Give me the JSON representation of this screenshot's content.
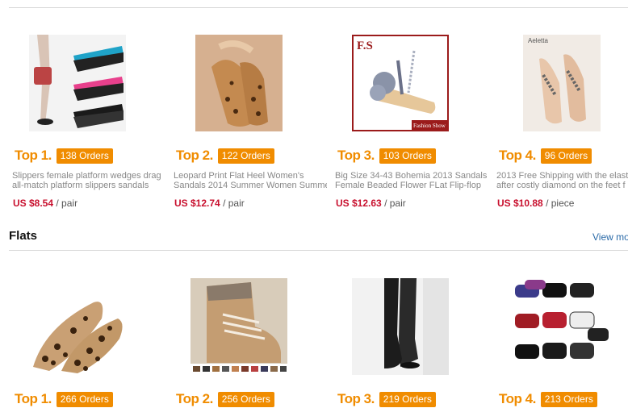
{
  "bestsellers": [
    {
      "top": "Top 1.",
      "orders": "138 Orders",
      "title1": "Slippers female platform wedges drag",
      "title2": "all-match platform slippers sandals",
      "price": "US $8.54",
      "unit": "/ pair",
      "img_logo": ""
    },
    {
      "top": "Top 2.",
      "orders": "122 Orders",
      "title1": "Leopard Print Flat Heel Women's",
      "title2": "Sandals 2014 Summer Women Summer",
      "price": "US $12.74",
      "unit": "/ pair",
      "img_logo": ""
    },
    {
      "top": "Top 3.",
      "orders": "103 Orders",
      "title1": "Big Size 34-43 Bohemia 2013 Sandals",
      "title2": "Female Beaded Flower FLat Flip-flop",
      "price": "US $12.63",
      "unit": "/ pair",
      "img_logo": "F.S",
      "img_caption": "Fashion Show"
    },
    {
      "top": "Top 4.",
      "orders": "96 Orders",
      "title1": "2013 Free Shipping with the elastic",
      "title2": "after costly diamond on the feet f",
      "price": "US $10.88",
      "unit": "/ piece",
      "img_logo": "Aeletta"
    }
  ],
  "flats": {
    "heading": "Flats",
    "view_more": "View mo",
    "items": [
      {
        "top": "Top 1.",
        "orders": "266 Orders"
      },
      {
        "top": "Top 2.",
        "orders": "256 Orders"
      },
      {
        "top": "Top 3.",
        "orders": "219 Orders"
      },
      {
        "top": "Top 4.",
        "orders": "213 Orders"
      }
    ]
  },
  "colors": {
    "accent": "#f08c00",
    "price": "#c8102e",
    "link": "#2a6aa8"
  }
}
